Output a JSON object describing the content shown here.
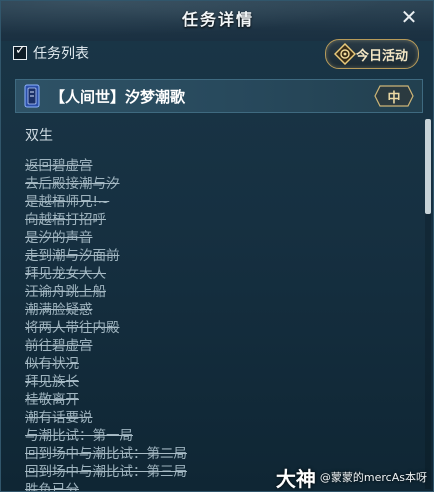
{
  "window": {
    "title": "任务详情"
  },
  "toolbar": {
    "task_list_label": "任务列表",
    "task_list_checked": true,
    "today_button_label": "今日活动"
  },
  "quest": {
    "name": "【人间世】汐梦潮歌",
    "difficulty": "中",
    "subtitle": "双生",
    "steps": [
      "返回碧虚宫",
      "去后殿接潮与汐",
      "是越梧师兄!~",
      "向越梧打招呼",
      "是汐的声音",
      "走到潮与汐面前",
      "拜见龙女大人",
      "汪谕舟跳上船",
      "潮满脸疑惑",
      "将两人带往内殿",
      "前往碧虚宫",
      "似有状况",
      "拜见族长",
      "桂敬离开",
      "潮有话要说",
      "与潮比试：第一局",
      "回到场中与潮比试：第二局",
      "回到场中与潮比试：第三局",
      "胜负已分"
    ]
  },
  "watermark": {
    "big": "大神",
    "small": "@蒙蒙的mercAs本呀"
  }
}
